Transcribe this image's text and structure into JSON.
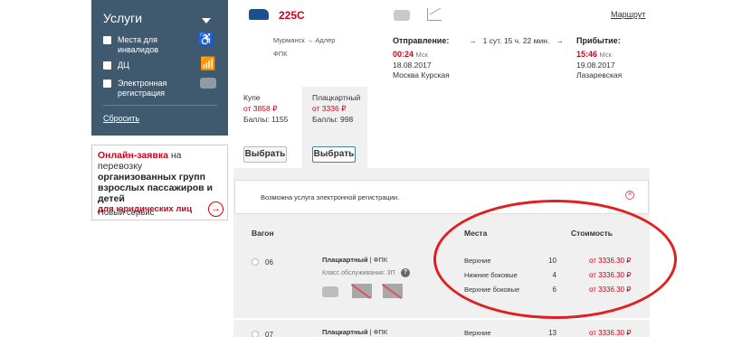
{
  "sidebar": {
    "title": "Услуги",
    "items": [
      {
        "label": "Места для инвалидов",
        "icon": "wheelchair-icon"
      },
      {
        "label": "ДЦ",
        "icon": "chart-icon"
      },
      {
        "label": "Электронная регистрация",
        "icon": "e-registration-icon"
      }
    ],
    "reset": "Сбросить"
  },
  "promo": {
    "part1": "Онлайн-заявка",
    "part2": " на перевозку ",
    "bold": "организованных групп взрослых пассажиров и детей",
    "service": "Новый сервис",
    "link": "для юридических лиц"
  },
  "train": {
    "number": "225С",
    "route_link": "Маршрут",
    "route": "Мурманск → Адлер",
    "carrier": "ФПК",
    "departure_label": "Отправление:",
    "arrival_label": "Прибытие:",
    "duration": "1 сут. 15 ч. 22 мин.",
    "dep_time": "00:24",
    "arr_time": "15:46",
    "tz": "Мск",
    "dep_date": "18.08.2017",
    "arr_date": "19.08.2017",
    "dep_station": "Москва Курская",
    "arr_station": "Лазаревская"
  },
  "car_types": [
    {
      "name": "Купе",
      "price": "от 3858 ₽",
      "points": "Баллы: 1155",
      "button": "Выбрать"
    },
    {
      "name": "Плацкартный",
      "price": "от 3336 ₽",
      "points": "Баллы: 998",
      "button": "Выбрать"
    }
  ],
  "notice": "Возможна услуга электронной регистрации.",
  "table": {
    "headers": {
      "wagon": "Вагон",
      "seats": "Места",
      "price": "Стоимость"
    },
    "rows": [
      {
        "num": "06",
        "class": "Плацкартный",
        "carrier": "ФПК",
        "service_class": "Класс обслуживания: 3П",
        "seats": [
          {
            "type": "Верхние",
            "count": "10",
            "price": "от 3336.30 ₽"
          },
          {
            "type": "Нижние боковые",
            "count": "4",
            "price": "от 3336.30 ₽"
          },
          {
            "type": "Верхние боковые",
            "count": "6",
            "price": "от 3336.30 ₽"
          }
        ]
      },
      {
        "num": "07",
        "class": "Плацкартный",
        "carrier": "ФПК",
        "seats": [
          {
            "type": "Верхние",
            "count": "13",
            "price": "от 3336.30 ₽"
          }
        ]
      }
    ]
  },
  "colors": {
    "accent": "#d0021b",
    "sidebar": "#3f5a6e",
    "annotation": "#e02020"
  }
}
